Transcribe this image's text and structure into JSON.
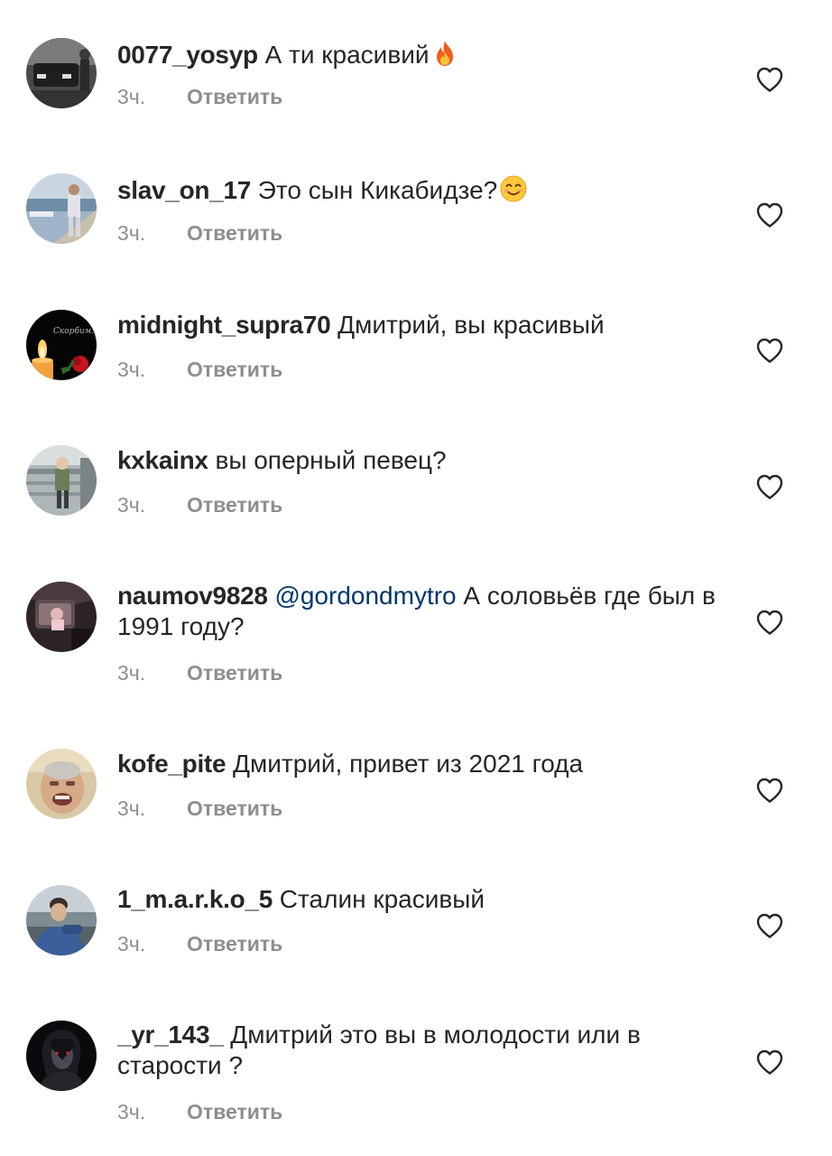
{
  "comments": [
    {
      "username": "0077_yosyp",
      "text": "А ти красивий",
      "emoji": "fire",
      "time": "3ч.",
      "reply": "Ответить"
    },
    {
      "username": "slav_on_17",
      "text": "Это сын Кикабидзе?",
      "emoji": "smile",
      "time": "3ч.",
      "reply": "Ответить"
    },
    {
      "username": "midnight_supra70",
      "text": "Дмитрий, вы красивый",
      "avatar_caption": "Скорбим...",
      "time": "3ч.",
      "reply": "Ответить"
    },
    {
      "username": "kxkainx",
      "text": "вы оперный певец?",
      "time": "3ч.",
      "reply": "Ответить"
    },
    {
      "username": "naumov9828",
      "mention": "@gordondmytro",
      "text": "А соловьёв где был в 1991 году?",
      "time": "3ч.",
      "reply": "Ответить"
    },
    {
      "username": "kofe_pite",
      "text": "Дмитрий, привет из 2021 года",
      "time": "3ч.",
      "reply": "Ответить"
    },
    {
      "username": "1_m.a.r.k.o_5",
      "text": "Сталин красивый",
      "time": "3ч.",
      "reply": "Ответить"
    },
    {
      "username": "_yr_143_",
      "text": "Дмитрий это вы в молодости или в старости ?",
      "time": "3ч.",
      "reply": "Ответить"
    }
  ],
  "icons": {
    "like": "heart-outline-icon",
    "fire": "fire-emoji-icon",
    "smile": "smiling-face-emoji-icon"
  },
  "colors": {
    "text": "#262626",
    "meta": "#8e8e8e",
    "mention": "#00376b",
    "heart": "#262626",
    "background": "#ffffff"
  }
}
